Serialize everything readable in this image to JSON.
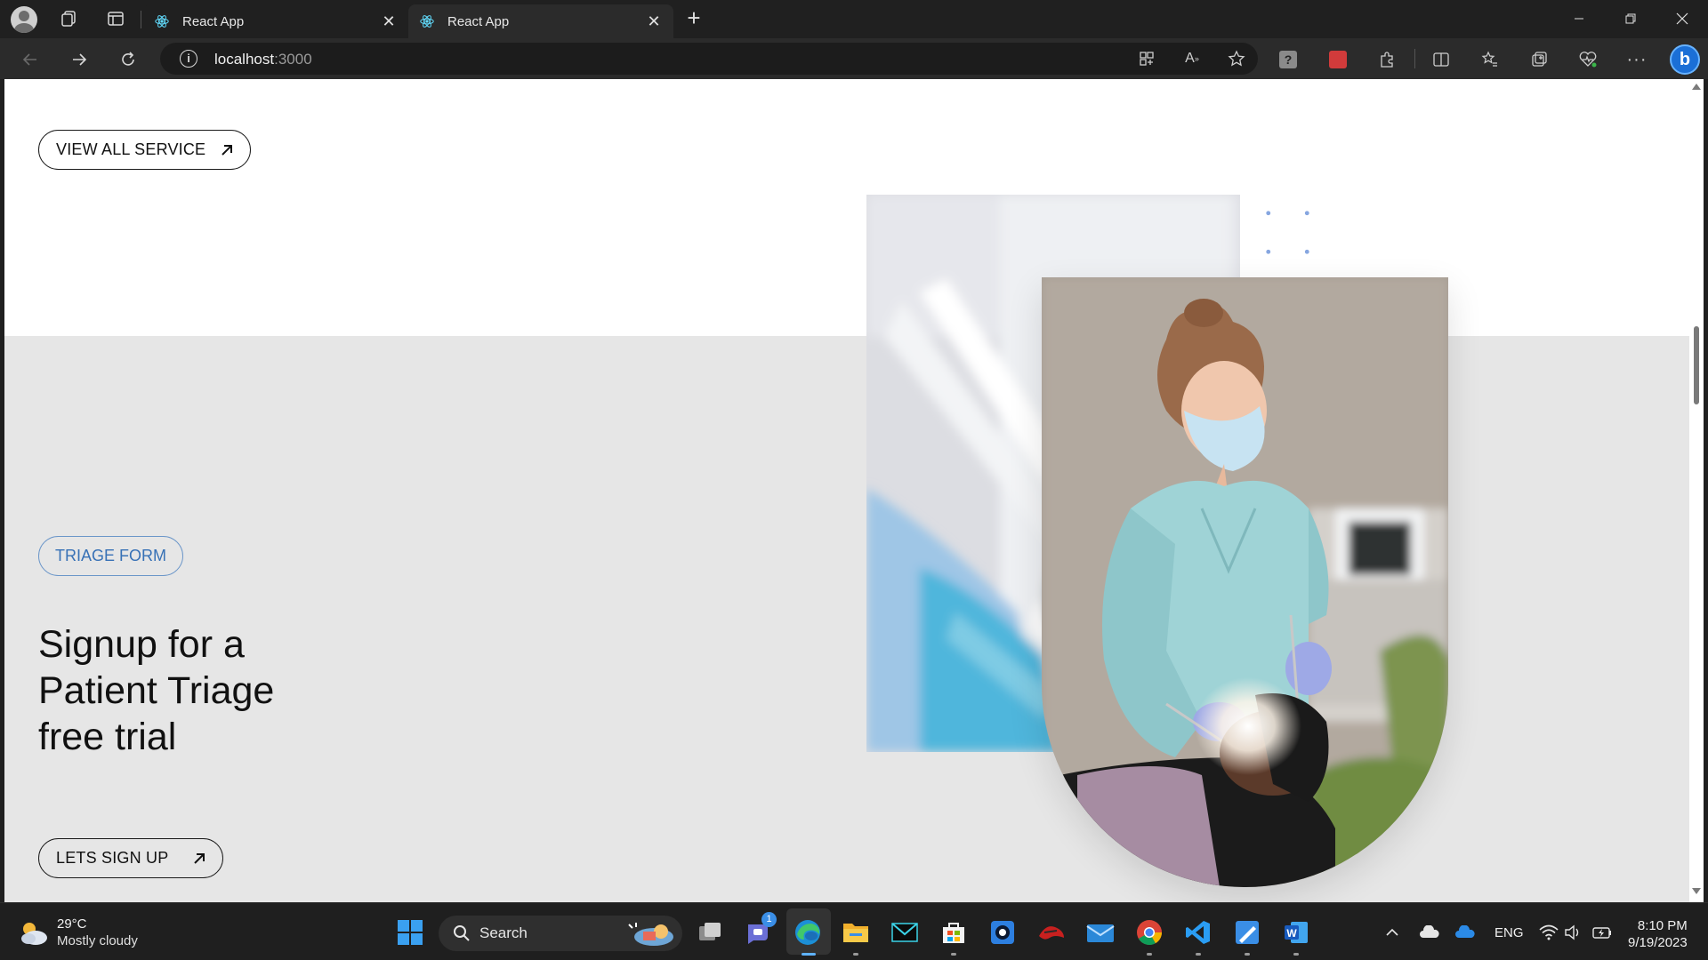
{
  "browser": {
    "tabs": [
      {
        "title": "React App",
        "active": false
      },
      {
        "title": "React App",
        "active": true
      }
    ],
    "url_host": "localhost",
    "url_port": ":3000"
  },
  "page": {
    "view_all_button": "VIEW ALL SERVICE",
    "triage_tag": "TRIAGE FORM",
    "headline": "Signup for a Patient Triage free trial",
    "signup_button": "LETS SIGN UP",
    "accent_color": "#3771b6",
    "band_color": "#e6e6e6",
    "dot_color": "#86a6e0"
  },
  "taskbar": {
    "weather_temp": "29°C",
    "weather_desc": "Mostly cloudy",
    "search_label": "Search",
    "chat_badge": "1",
    "language": "ENG",
    "time": "8:10 PM",
    "date": "9/19/2023"
  }
}
